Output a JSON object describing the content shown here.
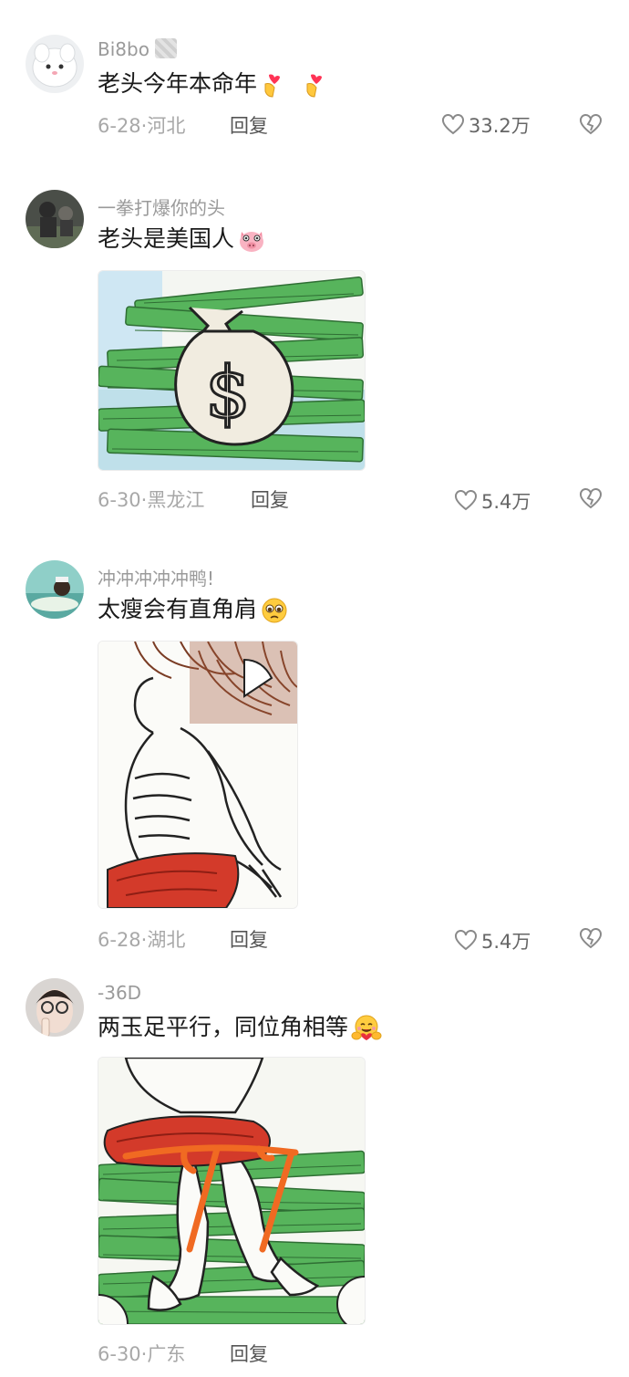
{
  "comments": [
    {
      "username": "Bi8bo",
      "text": "老头今年本命年",
      "date": "6-28",
      "location": "河北",
      "reply_label": "回复",
      "likes": "33.2万"
    },
    {
      "username": "一拳打爆你的头",
      "text": "老头是美国人",
      "date": "6-30",
      "location": "黑龙江",
      "reply_label": "回复",
      "likes": "5.4万"
    },
    {
      "username": "冲冲冲冲冲鸭!",
      "text": "太瘦会有直角肩",
      "date": "6-28",
      "location": "湖北",
      "reply_label": "回复",
      "likes": "5.4万"
    },
    {
      "username": "-36D",
      "text": "两玉足平行，同位角相等",
      "date": "6-30",
      "location": "广东",
      "reply_label": "回复",
      "likes": ""
    }
  ],
  "separator": "·",
  "icons": {
    "like": "heart-outline-icon",
    "dislike": "broken-heart-icon",
    "emoji_heart_hand": "finger-heart-emoji",
    "emoji_pig": "pig-face-emoji",
    "emoji_pleading": "pleading-face-emoji",
    "emoji_hug": "hugging-face-emoji"
  },
  "colors": {
    "username": "#9a9a9a",
    "meta": "#a8a8a8",
    "text": "#1a1a1a",
    "money_green": "#4caf50",
    "shorts_red": "#d33a2a",
    "annotation_orange": "#f06a22"
  }
}
